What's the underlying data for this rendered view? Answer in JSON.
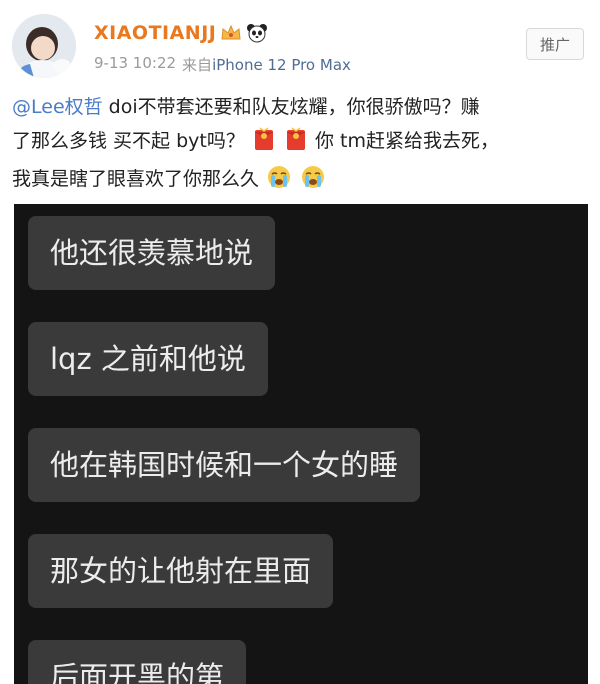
{
  "post": {
    "username": "XIAOTIANJJ",
    "timestamp": "9-13 10:22",
    "source_prefix": "来自",
    "device": "iPhone 12 Pro Max",
    "promo_button": "推广",
    "text": {
      "mention": "@Lee权哲",
      "line1_rest": " doi不带套还要和队友炫耀，你很骄傲吗？赚",
      "line2_a": "了那么多钱 买不起 byt吗？",
      "line2_b": "你 tm赶紧给我去死，",
      "line3": "我真是瞎了眼喜欢了你那么久"
    },
    "badge_icons": [
      "crown-icon",
      "panda-icon"
    ],
    "emoji_icons": [
      "red-envelope-icon",
      "red-envelope-icon",
      "crying-face-icon",
      "crying-face-icon"
    ]
  },
  "chat": {
    "messages": [
      "他还很羡慕地说",
      "lqz 之前和他说",
      "他在韩国时候和一个女的睡",
      "那女的让他射在里面",
      "后面开黑的第"
    ]
  },
  "colors": {
    "username": "#e9781f",
    "mention": "#4a7cc8",
    "chat_background": "#141414",
    "bubble": "#3a3a3a"
  }
}
